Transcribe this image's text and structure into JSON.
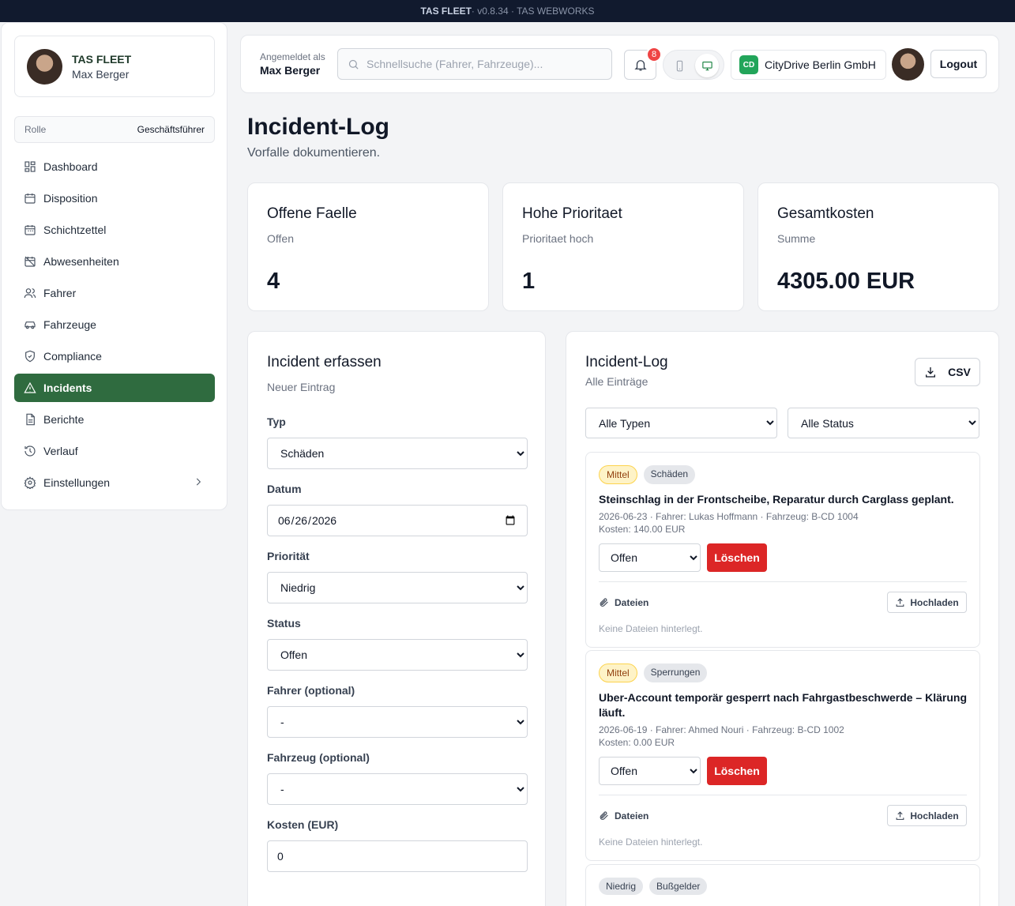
{
  "topbar": {
    "brand": "TAS FLEET",
    "version": " · v0.8.34 · TAS WEBWORKS"
  },
  "sidebar": {
    "app_name": "TAS FLEET",
    "user_name": "Max Berger",
    "role_label": "Rolle",
    "role_value": "Geschäftsführer",
    "items": [
      {
        "label": "Dashboard",
        "icon": "dashboard-icon"
      },
      {
        "label": "Disposition",
        "icon": "calendar-icon"
      },
      {
        "label": "Schichtzettel",
        "icon": "calendar-icon"
      },
      {
        "label": "Abwesenheiten",
        "icon": "calendar-off-icon"
      },
      {
        "label": "Fahrer",
        "icon": "users-icon"
      },
      {
        "label": "Fahrzeuge",
        "icon": "car-icon"
      },
      {
        "label": "Compliance",
        "icon": "shield-icon"
      },
      {
        "label": "Incidents",
        "icon": "warning-icon",
        "active": true
      },
      {
        "label": "Berichte",
        "icon": "document-icon"
      },
      {
        "label": "Verlauf",
        "icon": "history-icon"
      },
      {
        "label": "Einstellungen",
        "icon": "gear-icon"
      }
    ]
  },
  "header": {
    "signed_in_label": "Angemeldet als",
    "signed_in_user": "Max Berger",
    "search_placeholder": "Schnellsuche (Fahrer, Fahrzeuge)...",
    "notifications_count": "8",
    "company_initials": "CD",
    "company_name": "CityDrive Berlin GmbH",
    "logout_label": "Logout"
  },
  "page": {
    "title": "Incident-Log",
    "subtitle": "Vorfalle dokumentieren."
  },
  "stats": [
    {
      "title": "Offene Faelle",
      "subtitle": "Offen",
      "value": "4"
    },
    {
      "title": "Hohe Prioritaet",
      "subtitle": "Prioritaet hoch",
      "value": "1"
    },
    {
      "title": "Gesamtkosten",
      "subtitle": "Summe",
      "value": "4305.00 EUR"
    }
  ],
  "form": {
    "title": "Incident erfassen",
    "subtitle": "Neuer Eintrag",
    "type_label": "Typ",
    "type_value": "Schäden",
    "date_label": "Datum",
    "date_value": "2026-06-26",
    "priority_label": "Priorität",
    "priority_value": "Niedrig",
    "status_label": "Status",
    "status_value": "Offen",
    "driver_label": "Fahrer (optional)",
    "driver_value": "-",
    "vehicle_label": "Fahrzeug (optional)",
    "vehicle_value": "-",
    "cost_label": "Kosten (EUR)",
    "cost_value": "0"
  },
  "log": {
    "title": "Incident-Log",
    "subtitle": "Alle Einträge",
    "csv_label": "CSV",
    "filter_type": "Alle Typen",
    "filter_status": "Alle Status",
    "files_label": "Dateien",
    "upload_label": "Hochladen",
    "no_files": "Keine Dateien hinterlegt.",
    "delete_label": "Löschen",
    "entries": [
      {
        "priority": "Mittel",
        "type": "Schäden",
        "description": "Steinschlag in der Frontscheibe, Reparatur durch Carglass geplant.",
        "meta": "2026-06-23 · Fahrer: Lukas Hoffmann · Fahrzeug: B-CD 1004",
        "cost": "Kosten: 140.00 EUR",
        "status": "Offen"
      },
      {
        "priority": "Mittel",
        "type": "Sperrungen",
        "description": "Uber-Account temporär gesperrt nach Fahrgastbeschwerde – Klärung läuft.",
        "meta": "2026-06-19 · Fahrer: Ahmed Nouri · Fahrzeug: B-CD 1002",
        "cost": "Kosten: 0.00 EUR",
        "status": "Offen"
      },
      {
        "priority": "Niedrig",
        "type": "Bußgelder"
      }
    ]
  }
}
